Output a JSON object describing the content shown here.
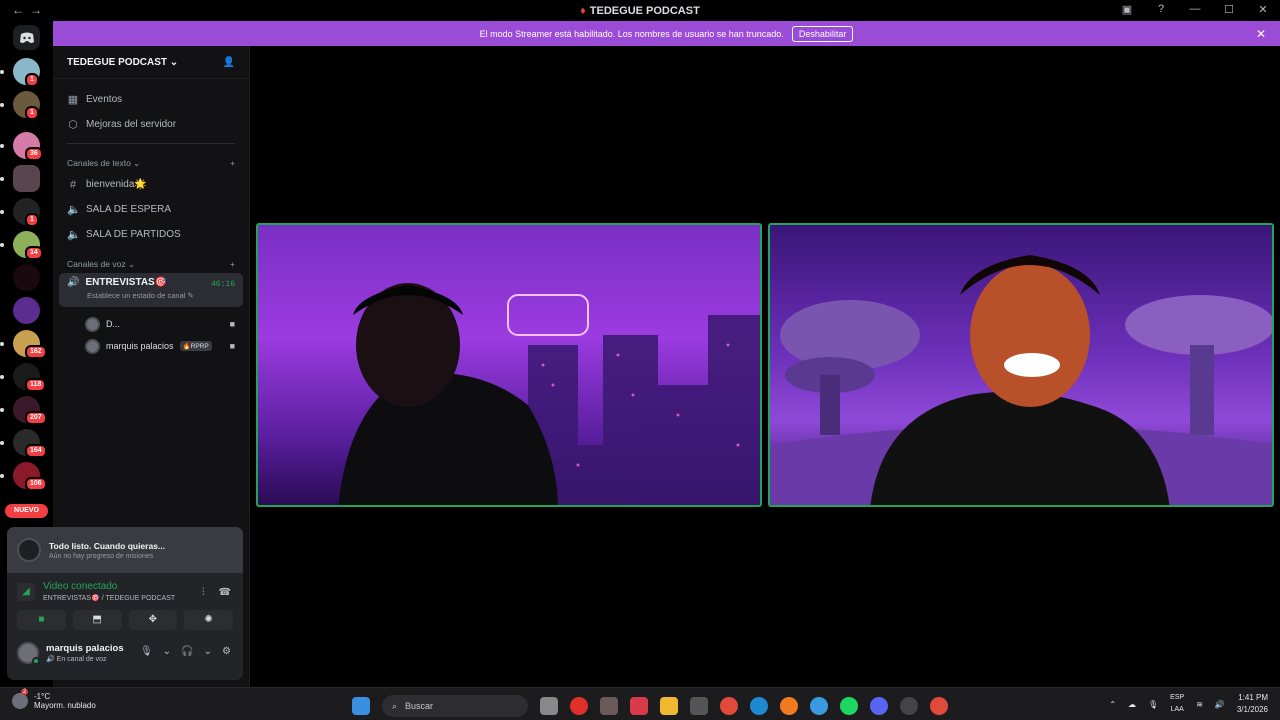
{
  "window": {
    "title": "TEDEGUE PODCAST"
  },
  "banner": {
    "message": "El modo Streamer está habilitado. Los nombres de usuario se han truncado.",
    "button": "Deshabilitar"
  },
  "rail": {
    "badges": [
      "1",
      "1",
      "36",
      "1",
      "14",
      "162",
      "118",
      "207",
      "164",
      "106"
    ],
    "nuevo": "NUEVO"
  },
  "server": {
    "name": "TEDEGUE PODCAST"
  },
  "nav": {
    "events": "Eventos",
    "boosts": "Mejoras del servidor"
  },
  "text_channels": {
    "category": "Canales de texto",
    "items": [
      "bienvenida",
      "SALA DE ESPERA",
      "SALA DE PARTIDOS"
    ],
    "emoji": "🌟"
  },
  "voice_channels": {
    "category": "Canales de voz",
    "active": {
      "name": "ENTREVISTAS",
      "emoji": "🎯",
      "status": "Establece un estado de canal",
      "timer": "46:16"
    },
    "users": [
      {
        "name": "D..."
      },
      {
        "name": "marquis palacios",
        "tag": "RPRP"
      }
    ]
  },
  "quest": {
    "title": "Todo listo. Cuando quieras...",
    "subtitle": "Aún no hay progreso de misiones"
  },
  "voice_status": {
    "title": "Video conectado",
    "channel": "ENTREVISTAS🎯 / TEDEGUE PODCAST"
  },
  "user": {
    "name": "marquis palacios",
    "status": "En canal de voz"
  },
  "taskbar": {
    "temp": "-1°C",
    "weather": "Mayorm. nublado",
    "weather_badge": "2",
    "search": "Buscar",
    "lang1": "ESP",
    "lang2": "LAA",
    "time": "1:41 PM",
    "date": "3/1/2026"
  }
}
